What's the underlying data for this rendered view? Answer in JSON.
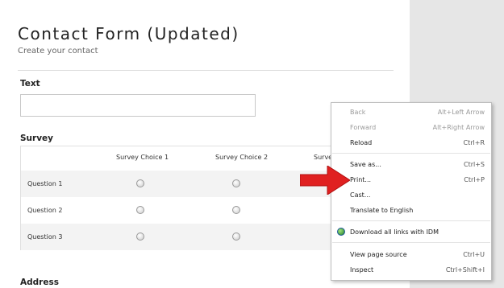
{
  "form": {
    "title": "Contact Form (Updated)",
    "subtitle": "Create your contact",
    "text_label": "Text",
    "text_value": "",
    "survey_label": "Survey",
    "address_label": "Address"
  },
  "survey": {
    "columns": [
      "Survey Choice 1",
      "Survey Choice 2",
      "Survey"
    ],
    "rows": [
      "Question 1",
      "Question 2",
      "Question 3"
    ]
  },
  "context_menu": {
    "items": [
      {
        "label": "Back",
        "shortcut": "Alt+Left Arrow",
        "enabled": false
      },
      {
        "label": "Forward",
        "shortcut": "Alt+Right Arrow",
        "enabled": false
      },
      {
        "label": "Reload",
        "shortcut": "Ctrl+R",
        "enabled": true
      },
      {
        "label": "Save as...",
        "shortcut": "Ctrl+S",
        "enabled": true
      },
      {
        "label": "Print...",
        "shortcut": "Ctrl+P",
        "enabled": true
      },
      {
        "label": "Cast...",
        "shortcut": "",
        "enabled": true
      },
      {
        "label": "Translate to English",
        "shortcut": "",
        "enabled": true
      },
      {
        "label": "Download all links with IDM",
        "shortcut": "",
        "enabled": true,
        "icon": "idm-icon"
      },
      {
        "label": "View page source",
        "shortcut": "Ctrl+U",
        "enabled": true
      },
      {
        "label": "Inspect",
        "shortcut": "Ctrl+Shift+I",
        "enabled": true
      }
    ]
  },
  "colors": {
    "arrow": "#e02020",
    "menu_border": "#bdbdbd",
    "disabled_text": "#9a9a9a"
  }
}
